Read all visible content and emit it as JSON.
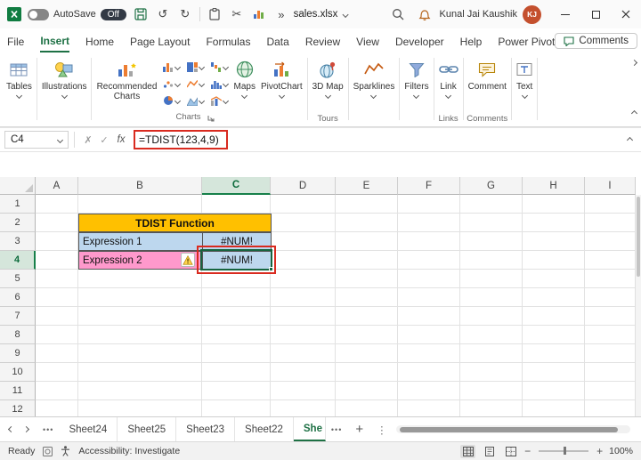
{
  "titlebar": {
    "autosave_label": "AutoSave",
    "autosave_state": "Off",
    "filename": "sales.xlsx",
    "user_name": "Kunal Jai Kaushik",
    "user_initials": "KJ"
  },
  "menubar": {
    "tabs": [
      "File",
      "Insert",
      "Home",
      "Page Layout",
      "Formulas",
      "Data",
      "Review",
      "View",
      "Developer",
      "Help",
      "Power Pivot"
    ],
    "active_tab": "Insert",
    "comments_label": "Comments"
  },
  "ribbon": {
    "buttons": {
      "tables": "Tables",
      "illustrations": "Illustrations",
      "recommended_charts": "Recommended Charts",
      "maps": "Maps",
      "pivotchart": "PivotChart",
      "map3d": "3D Map",
      "sparklines": "Sparklines",
      "filters": "Filters",
      "link": "Link",
      "comment": "Comment",
      "text": "Text"
    },
    "group_labels": {
      "charts": "Charts",
      "tours": "Tours",
      "links": "Links",
      "comments": "Comments"
    }
  },
  "formula_bar": {
    "name_box": "C4",
    "formula": "=TDIST(123,4,9)"
  },
  "grid": {
    "columns": [
      "A",
      "B",
      "C",
      "D",
      "E",
      "F",
      "G",
      "H",
      "I"
    ],
    "row_count": 12,
    "selected_column": "C",
    "selected_row": "4",
    "active_cell": "C4",
    "cells": {
      "title": "TDIST Function",
      "expression1_label": "Expression 1",
      "expression1_value": "#NUM!",
      "expression2_label": "Expression 2",
      "expression2_value": "#NUM!"
    },
    "colors": {
      "title_bg": "#FFC000",
      "expression1_bg": "#BDD7EE",
      "expression2_bg": "#FF99CC",
      "value_bg": "#BDD7EE",
      "annotation_red": "#D92B20",
      "selection_green": "#17643F"
    }
  },
  "sheet_bar": {
    "tabs": [
      "Sheet24",
      "Sheet25",
      "Sheet23",
      "Sheet22",
      "She"
    ],
    "active_tab": "She"
  },
  "status_bar": {
    "mode": "Ready",
    "accessibility": "Accessibility: Investigate",
    "zoom": "100%"
  },
  "icons": {
    "scissors": "✂",
    "undo": "↺",
    "redo": "↻",
    "overflow": "»",
    "cancel": "✗",
    "enter": "✓",
    "fx": "fx",
    "dots": "•••",
    "add": "+",
    "kebab": "⋮",
    "zoom_minus": "−",
    "zoom_plus": "+"
  }
}
